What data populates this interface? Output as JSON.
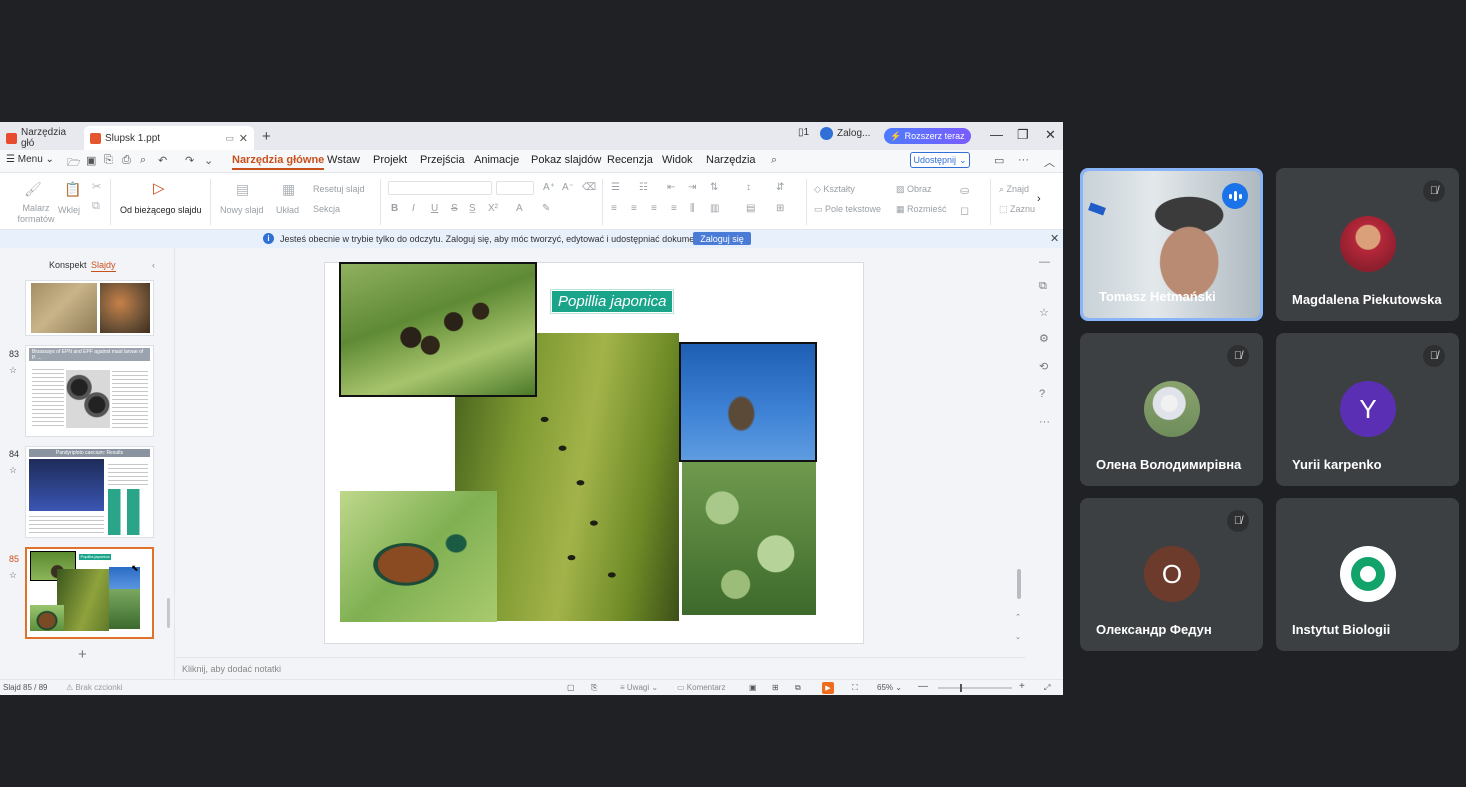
{
  "window": {
    "tabs": [
      {
        "label": "Narzędzia głó",
        "logo_color": "#e84a2f"
      },
      {
        "label": "Slupsk 1.ppt",
        "logo_color": "#e4572e"
      }
    ],
    "account_label": "Zalog...",
    "upgrade_label": "Rozszerz teraz"
  },
  "menubar": {
    "menu_label": "Menu",
    "ribbon_tabs": [
      "Narzędzia główne",
      "Wstaw",
      "Projekt",
      "Przejścia",
      "Animacje",
      "Pokaz slajdów",
      "Recenzja",
      "Widok",
      "Narzędzia"
    ],
    "share_label": "Udostępnij"
  },
  "ribbon": {
    "painter": "Malarz formatów",
    "paste": "Wklej",
    "from_current": "Od bieżącego slajdu",
    "new_slide": "Nowy slajd",
    "layout": "Układ",
    "reset_slide": "Resetuj slajd",
    "section": "Sekcja",
    "shapes": "Kształty",
    "picture": "Obraz",
    "textbox": "Pole tekstowe",
    "arrange": "Rozmieść",
    "find": "Znajd",
    "select": "Zaznu"
  },
  "infobar": {
    "message": "Jesteś obecnie w trybie tylko do odczytu. Zaloguj się, aby móc tworzyć, edytować i udostępniać dokumenty.",
    "login_label": "Zaloguj się"
  },
  "leftpanel": {
    "tab_outline": "Konspekt",
    "tab_slides": "Slajdy",
    "slides": [
      {
        "number": "83",
        "title": "Bioassays of EPN and EPF against mast larvae of P. ...",
        "active": false
      },
      {
        "number": "84",
        "title": "Pandyriploto caecium: Results",
        "active": false
      },
      {
        "number": "85",
        "title": "Popillia japonica",
        "active": true
      }
    ]
  },
  "slide": {
    "title": "Popillia japonica"
  },
  "notes": {
    "placeholder": "Kliknij, aby dodać notatki"
  },
  "statusbar": {
    "slide_counter": "Slajd 85 / 89",
    "font_status": "Brak czcionki",
    "notes_label": "Uwagi",
    "comment_label": "Komentarz",
    "zoom": "65%"
  },
  "participants": [
    {
      "name": "Tomasz Hetmański",
      "muted": false,
      "speaking": true,
      "avatar_type": "video",
      "avatar_color": "#7a8a94"
    },
    {
      "name": "Magdalena Piekutowska",
      "muted": true,
      "speaking": false,
      "avatar_type": "photo",
      "avatar_color": "#b5273a"
    },
    {
      "name": "Олена Володимирівна",
      "muted": true,
      "speaking": false,
      "avatar_type": "photo",
      "avatar_color": "#8aa36e"
    },
    {
      "name": "Yurii karpenko",
      "muted": true,
      "speaking": false,
      "avatar_type": "letter",
      "letter": "Y",
      "avatar_color": "#5b2fb4"
    },
    {
      "name": "Олександр Федун",
      "muted": true,
      "speaking": false,
      "avatar_type": "letter",
      "letter": "O",
      "avatar_color": "#6d3b2b"
    },
    {
      "name": "Instytut Biologii",
      "muted": false,
      "speaking": false,
      "avatar_type": "ring",
      "avatar_color": "#12a36b"
    }
  ]
}
